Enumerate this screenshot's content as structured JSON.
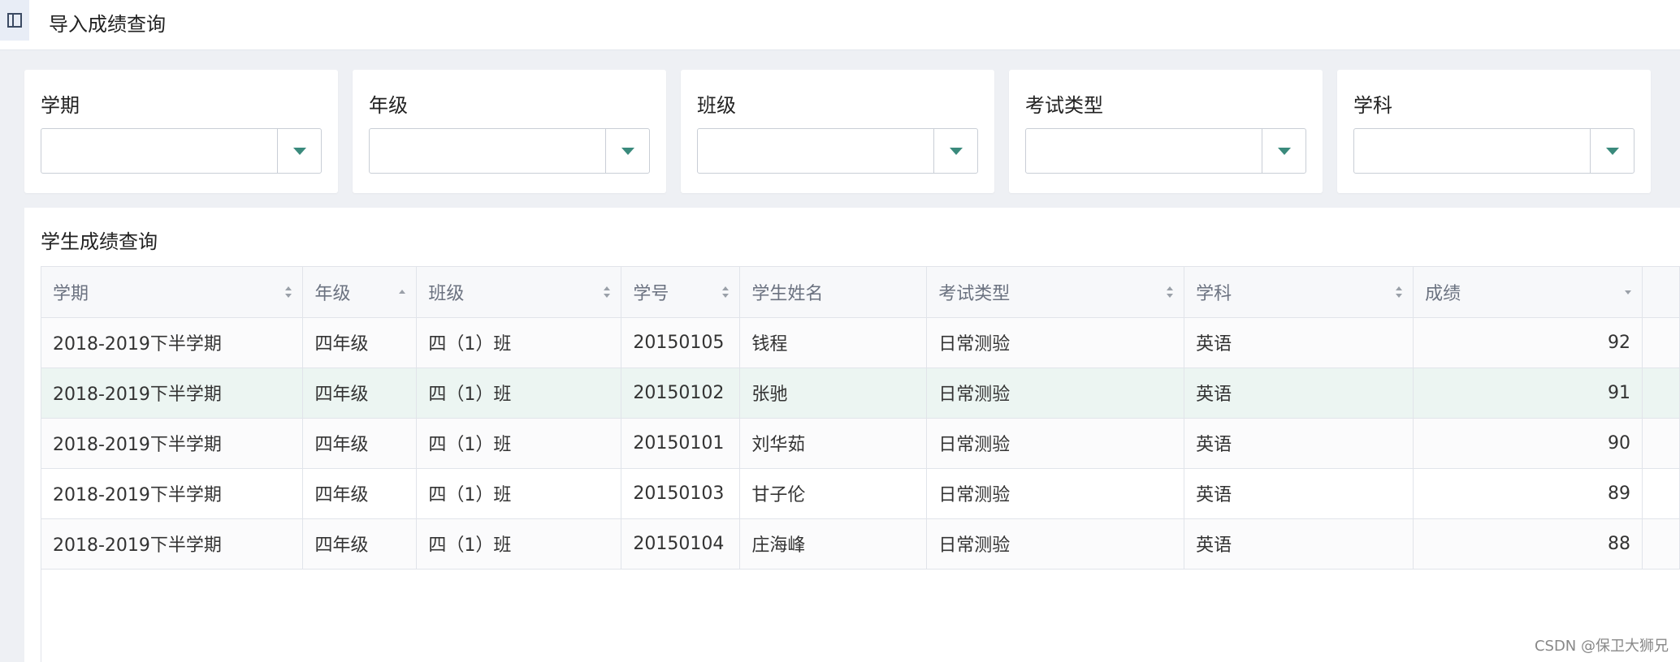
{
  "header": {
    "toggle_icon": "sidebar-toggle-icon",
    "title": "导入成绩查询"
  },
  "filters": [
    {
      "label": "学期",
      "value": ""
    },
    {
      "label": "年级",
      "value": ""
    },
    {
      "label": "班级",
      "value": ""
    },
    {
      "label": "考试类型",
      "value": ""
    },
    {
      "label": "学科",
      "value": ""
    }
  ],
  "results": {
    "title": "学生成绩查询",
    "columns": [
      {
        "label": "学期",
        "sort": "both"
      },
      {
        "label": "年级",
        "sort": "asc"
      },
      {
        "label": "班级",
        "sort": "both"
      },
      {
        "label": "学号",
        "sort": "both"
      },
      {
        "label": "学生姓名",
        "sort": "none"
      },
      {
        "label": "考试类型",
        "sort": "both"
      },
      {
        "label": "学科",
        "sort": "both"
      },
      {
        "label": "成绩",
        "sort": "desc"
      }
    ],
    "rows": [
      [
        "2018-2019下半学期",
        "四年级",
        "四（1）班",
        "20150105",
        "钱程",
        "日常测验",
        "英语",
        "92"
      ],
      [
        "2018-2019下半学期",
        "四年级",
        "四（1）班",
        "20150102",
        "张驰",
        "日常测验",
        "英语",
        "91"
      ],
      [
        "2018-2019下半学期",
        "四年级",
        "四（1）班",
        "20150101",
        "刘华茹",
        "日常测验",
        "英语",
        "90"
      ],
      [
        "2018-2019下半学期",
        "四年级",
        "四（1）班",
        "20150103",
        "甘子伦",
        "日常测验",
        "英语",
        "89"
      ],
      [
        "2018-2019下半学期",
        "四年级",
        "四（1）班",
        "20150104",
        "庄海峰",
        "日常测验",
        "英语",
        "88"
      ]
    ],
    "selected_row": 1
  },
  "watermark": "CSDN @保卫大狮兄",
  "colors": {
    "accent": "#3a8a7c",
    "selected_row_bg": "#ecf5f2",
    "page_bg": "#eef0f4"
  }
}
